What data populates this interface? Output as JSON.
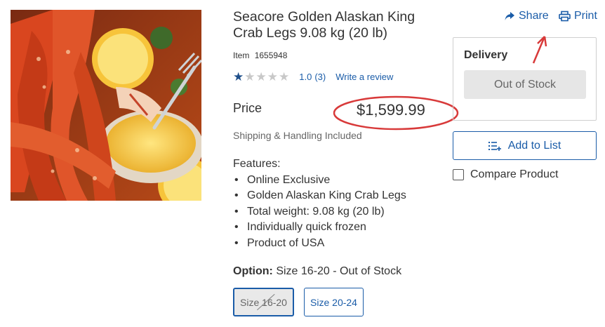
{
  "product": {
    "title": "Seacore Golden Alaskan King Crab Legs 9.08 kg (20 lb)",
    "item_label": "Item",
    "item_number": "1655948",
    "rating_value": "1.0",
    "rating_count": "(3)",
    "rating_stars_filled": 1,
    "rating_stars_total": 5,
    "write_review": "Write a review",
    "price_label": "Price",
    "price": "$1,599.99",
    "shipping": "Shipping & Handling Included",
    "features_title": "Features:",
    "features": [
      "Online Exclusive",
      "Golden Alaskan King Crab Legs",
      "Total weight: 9.08 kg (20 lb)",
      "Individually quick frozen",
      "Product of USA"
    ],
    "option_label": "Option:",
    "option_value": "Size 16-20 - Out of Stock",
    "sizes": [
      {
        "label": "Size 16-20",
        "selected": true,
        "out_of_stock": true
      },
      {
        "label": "Size 20-24",
        "selected": false,
        "out_of_stock": false
      }
    ]
  },
  "actions": {
    "share": "Share",
    "print": "Print",
    "add_to_list": "Add to List",
    "compare": "Compare Product",
    "compare_checked": false
  },
  "delivery": {
    "title": "Delivery",
    "status_button": "Out of Stock"
  },
  "icons": {
    "share": "share-arrow-icon",
    "print": "printer-icon",
    "list": "list-add-icon",
    "star": "star-icon"
  },
  "colors": {
    "link_blue": "#1a5ca8",
    "annotation_red": "#d83a3a",
    "star_filled": "#1f4f8a",
    "star_empty": "#c8c8c8",
    "disabled_gray": "#e6e6e6"
  }
}
